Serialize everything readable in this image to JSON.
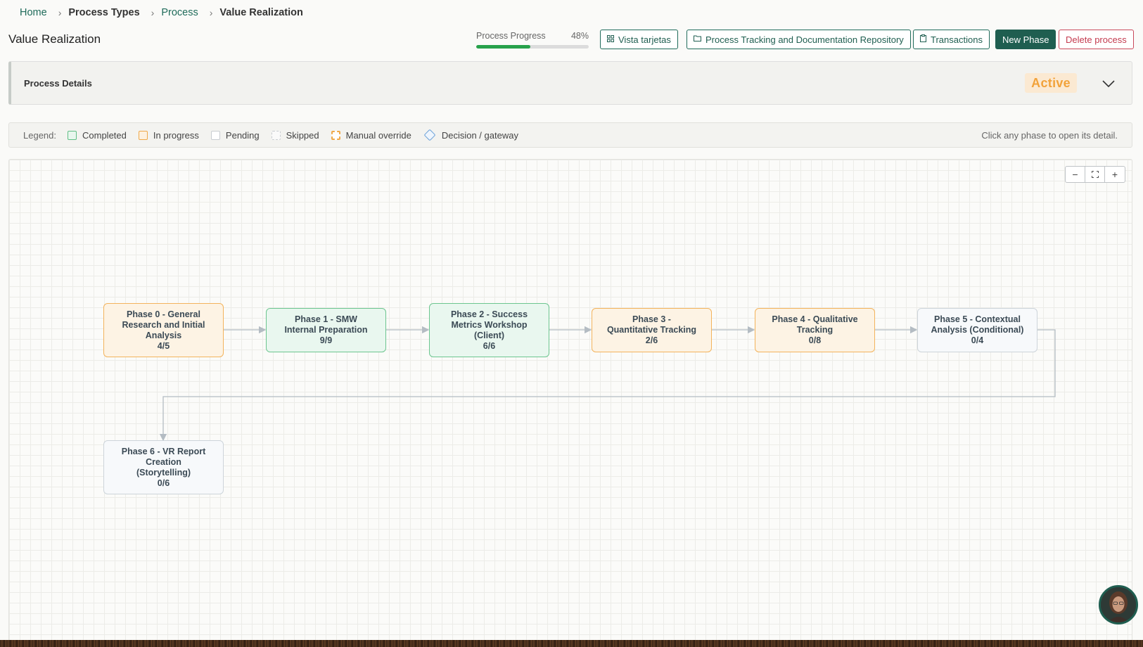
{
  "breadcrumb": {
    "home": "Home",
    "process_types": "Process Types",
    "process": "Process",
    "current": "Value Realization",
    "separator": "›"
  },
  "header": {
    "title": "Value Realization",
    "progress_label": "Process Progress",
    "progress_value": "48%",
    "progress_fraction": 0.48,
    "buttons": {
      "cards": "Vista tarjetas",
      "repository": "Process Tracking and Documentation Repository",
      "transactions": "Transactions",
      "new_phase": "New Phase",
      "delete": "Delete process"
    }
  },
  "details": {
    "title": "Process Details",
    "status": "Active"
  },
  "legend": {
    "label": "Legend:",
    "items": [
      "Completed",
      "In progress",
      "Pending",
      "Skipped",
      "Manual override",
      "Decision / gateway"
    ],
    "hint": "Click any phase to open its detail."
  },
  "zoom": {
    "out": "−",
    "fit": "⛶",
    "in": "+"
  },
  "phases": [
    {
      "line1": "Phase 0 - General",
      "line2": "Research and Initial",
      "line3": "Analysis",
      "count": "4/5",
      "status": "in-progress"
    },
    {
      "line1": "Phase 1 - SMW",
      "line2": "Internal Preparation",
      "line3": "",
      "count": "9/9",
      "status": "completed"
    },
    {
      "line1": "Phase 2 - Success",
      "line2": "Metrics Workshop",
      "line3": "(Client)",
      "count": "6/6",
      "status": "completed"
    },
    {
      "line1": "Phase 3 -",
      "line2": "Quantitative Tracking",
      "line3": "",
      "count": "2/6",
      "status": "in-progress"
    },
    {
      "line1": "Phase 4 - Qualitative",
      "line2": "Tracking",
      "line3": "",
      "count": "0/8",
      "status": "in-progress"
    },
    {
      "line1": "Phase 5 - Contextual",
      "line2": "Analysis (Conditional)",
      "line3": "",
      "count": "0/4",
      "status": "pending"
    },
    {
      "line1": "Phase 6 - VR Report",
      "line2": "Creation",
      "line3": "(Storytelling)",
      "count": "0/6",
      "status": "pending"
    }
  ],
  "colors": {
    "brand": "#1f5e50",
    "progress_fill": "#27a24b",
    "status_active": "#f2a23a",
    "danger": "#c43b4f"
  }
}
